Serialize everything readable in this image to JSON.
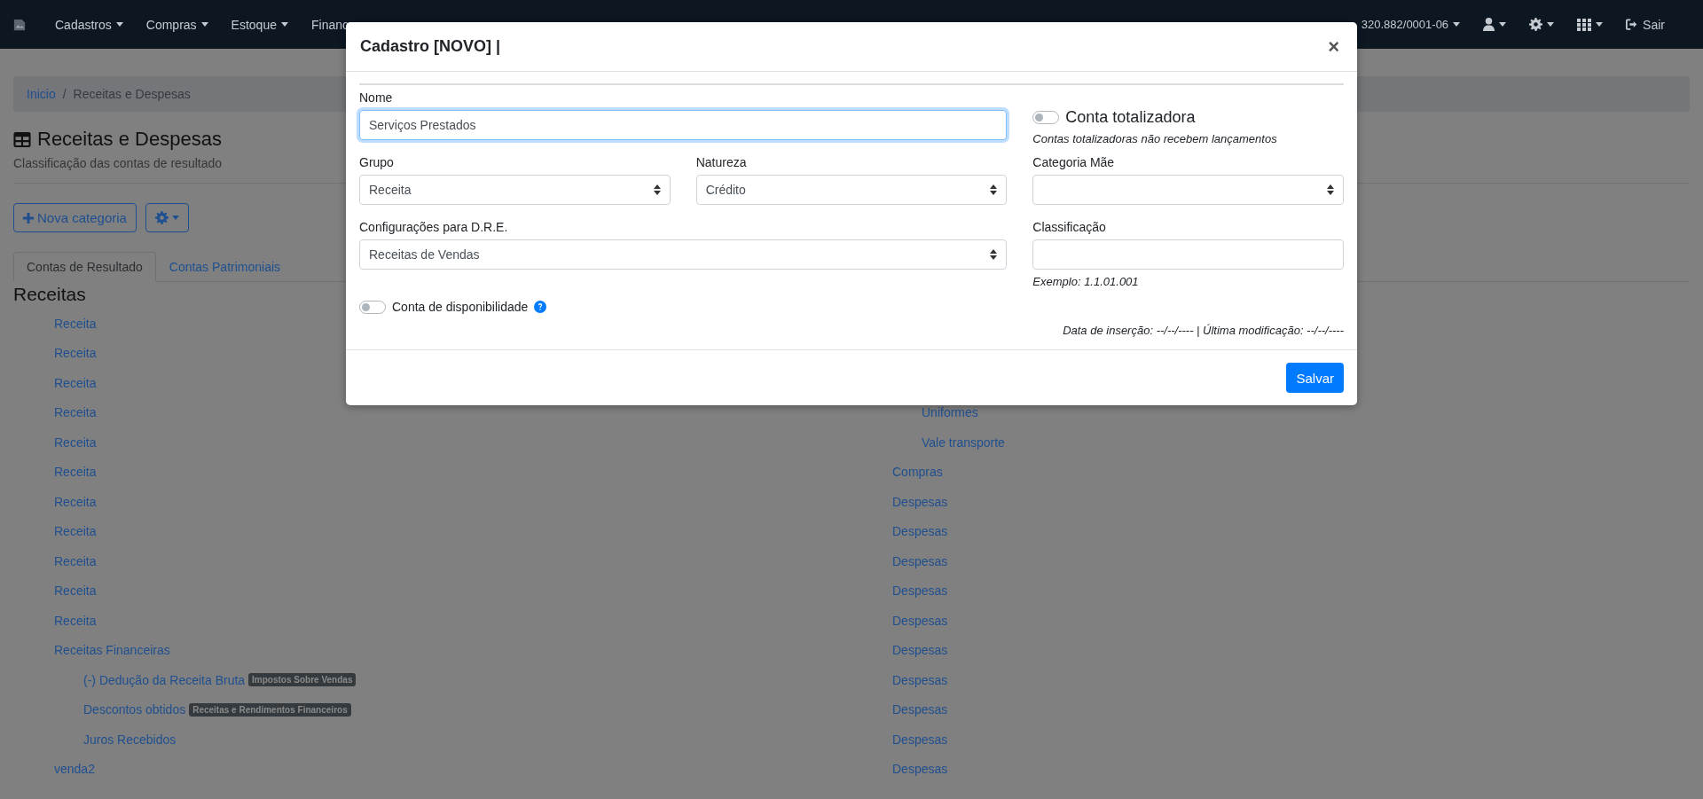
{
  "navbar": {
    "menu": [
      {
        "label": "Cadastros"
      },
      {
        "label": "Compras"
      },
      {
        "label": "Estoque"
      },
      {
        "label": "Financ"
      }
    ],
    "company": "320.882/0001-06",
    "logout": "Sair"
  },
  "breadcrumb": {
    "items": [
      "Inicio",
      "Receitas e Despesas"
    ],
    "separator": "/"
  },
  "page": {
    "title": "Receitas e Despesas",
    "subtitle": "Classificação das contas de resultado",
    "new_button": "Nova categoria"
  },
  "tabs": [
    {
      "label": "Contas de Resultado",
      "selected": true
    },
    {
      "label": "Contas Patrimoniais",
      "selected": false
    }
  ],
  "section": {
    "heading": "Receitas"
  },
  "left_tree": [
    {
      "label": "Receita"
    },
    {
      "label": "Receita"
    },
    {
      "label": "Receita"
    },
    {
      "label": "Receita"
    },
    {
      "label": "Receita"
    },
    {
      "label": "Receita"
    },
    {
      "label": "Receita"
    },
    {
      "label": "Receita"
    },
    {
      "label": "Receita"
    },
    {
      "label": "Receita"
    },
    {
      "label": "Receita"
    },
    {
      "label": "Receitas Financeiras",
      "children": [
        {
          "label": "(-) Dedução da Receita Bruta",
          "badge": "Impostos Sobre Vendas"
        },
        {
          "label": "Descontos obtidos",
          "badge": "Receitas e Rendimentos Financeiros"
        },
        {
          "label": "Juros Recebidos"
        }
      ]
    },
    {
      "label": "venda2"
    }
  ],
  "right_tree": {
    "continued_children": [
      {
        "label": "Uniformes"
      },
      {
        "label": "Vale transporte"
      }
    ],
    "items": [
      {
        "label": "Compras"
      },
      {
        "label": "Despesas"
      },
      {
        "label": "Despesas"
      },
      {
        "label": "Despesas"
      },
      {
        "label": "Despesas"
      },
      {
        "label": "Despesas"
      },
      {
        "label": "Despesas"
      },
      {
        "label": "Despesas"
      },
      {
        "label": "Despesas"
      },
      {
        "label": "Despesas"
      },
      {
        "label": "Despesas"
      }
    ]
  },
  "modal": {
    "title": "Cadastro [NOVO] |",
    "close": "×",
    "nome": {
      "label": "Nome",
      "value": "Serviços Prestados",
      "focused": true
    },
    "conta_totalizadora": {
      "label": "Conta totalizadora",
      "on": false,
      "hint": "Contas totalizadoras não recebem lançamentos"
    },
    "grupo": {
      "label": "Grupo",
      "value": "Receita"
    },
    "natureza": {
      "label": "Natureza",
      "value": "Crédito"
    },
    "categoria_mae": {
      "label": "Categoria Mãe"
    },
    "dre": {
      "label": "Configurações para D.R.E.",
      "value": "Receitas de Vendas"
    },
    "classificacao": {
      "label": "Classificação",
      "hint": "Exemplo: 1.1.01.001"
    },
    "conta_disponibilidade": {
      "label": "Conta de disponibilidade",
      "on": false
    },
    "timestamps": "Data de inserção: --/--/---- | Última modificação: --/--/----",
    "save_button": "Salvar"
  }
}
